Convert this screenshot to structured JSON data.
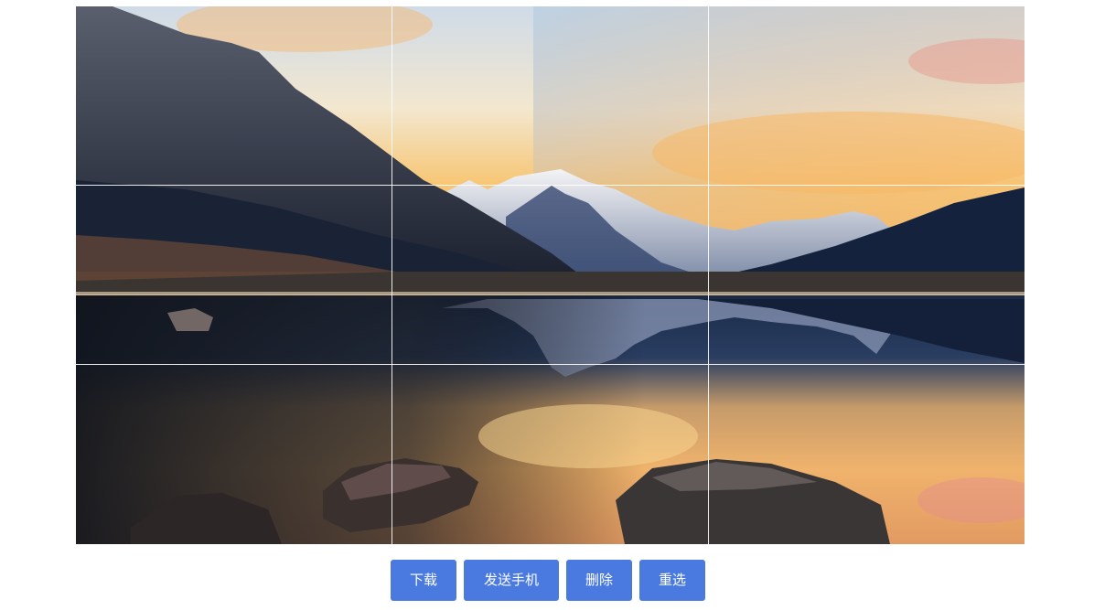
{
  "photo": {
    "grid": {
      "rows": 3,
      "cols": 3
    },
    "grid_line_color": "#ffffff"
  },
  "toolbar": {
    "download_label": "下载",
    "send_phone_label": "发送手机",
    "delete_label": "删除",
    "reselect_label": "重选",
    "button_color": "#4a7ae0"
  }
}
